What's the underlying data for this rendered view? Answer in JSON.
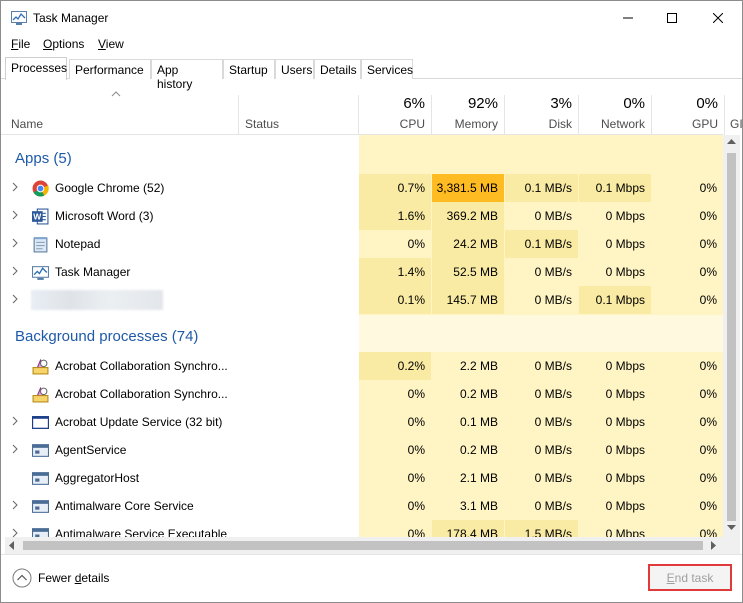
{
  "window": {
    "title": "Task Manager"
  },
  "menu": [
    {
      "accel": "F",
      "rest": "ile"
    },
    {
      "accel": "O",
      "rest": "ptions"
    },
    {
      "accel": "V",
      "rest": "iew"
    }
  ],
  "tabs": [
    "Processes",
    "Performance",
    "App history",
    "Startup",
    "Users",
    "Details",
    "Services"
  ],
  "active_tab": "Processes",
  "columns": {
    "name": "Name",
    "status": "Status",
    "cpu": {
      "pct": "6%",
      "label": "CPU"
    },
    "memory": {
      "pct": "92%",
      "label": "Memory"
    },
    "disk": {
      "pct": "3%",
      "label": "Disk"
    },
    "network": {
      "pct": "0%",
      "label": "Network"
    },
    "gpu": {
      "pct": "0%",
      "label": "GPU"
    },
    "gpu_engine_partial": "GI"
  },
  "groups": {
    "apps": "Apps (5)",
    "background": "Background processes (74)"
  },
  "apps": [
    {
      "name": "Google Chrome (52)",
      "icon": "chrome-icon",
      "cpu": "0.7%",
      "memory": "3,381.5 MB",
      "disk": "0.1 MB/s",
      "network": "0.1 Mbps",
      "gpu": "0%"
    },
    {
      "name": "Microsoft Word (3)",
      "icon": "word-icon",
      "cpu": "1.6%",
      "memory": "369.2 MB",
      "disk": "0 MB/s",
      "network": "0 Mbps",
      "gpu": "0%"
    },
    {
      "name": "Notepad",
      "icon": "notepad-icon",
      "cpu": "0%",
      "memory": "24.2 MB",
      "disk": "0.1 MB/s",
      "network": "0 Mbps",
      "gpu": "0%"
    },
    {
      "name": "Task Manager",
      "icon": "task-manager-icon",
      "cpu": "1.4%",
      "memory": "52.5 MB",
      "disk": "0 MB/s",
      "network": "0 Mbps",
      "gpu": "0%"
    },
    {
      "name": "",
      "icon": "blurred-app-icon",
      "cpu": "0.1%",
      "memory": "145.7 MB",
      "disk": "0 MB/s",
      "network": "0.1 Mbps",
      "gpu": "0%"
    }
  ],
  "background": [
    {
      "name": "Acrobat Collaboration Synchro...",
      "icon": "acrobat-sync-icon",
      "cpu": "0.2%",
      "memory": "2.2 MB",
      "disk": "0 MB/s",
      "network": "0 Mbps",
      "gpu": "0%"
    },
    {
      "name": "Acrobat Collaboration Synchro...",
      "icon": "acrobat-sync-icon",
      "cpu": "0%",
      "memory": "0.2 MB",
      "disk": "0 MB/s",
      "network": "0 Mbps",
      "gpu": "0%"
    },
    {
      "name": "Acrobat Update Service (32 bit)",
      "icon": "service-window-icon",
      "cpu": "0%",
      "memory": "0.1 MB",
      "disk": "0 MB/s",
      "network": "0 Mbps",
      "gpu": "0%"
    },
    {
      "name": "AgentService",
      "icon": "service-window-icon",
      "cpu": "0%",
      "memory": "0.2 MB",
      "disk": "0 MB/s",
      "network": "0 Mbps",
      "gpu": "0%"
    },
    {
      "name": "AggregatorHost",
      "icon": "service-window-icon",
      "cpu": "0%",
      "memory": "2.1 MB",
      "disk": "0 MB/s",
      "network": "0 Mbps",
      "gpu": "0%"
    },
    {
      "name": "Antimalware Core Service",
      "icon": "service-window-icon",
      "cpu": "0%",
      "memory": "3.1 MB",
      "disk": "0 MB/s",
      "network": "0 Mbps",
      "gpu": "0%"
    },
    {
      "name": "Antimalware Service Executable",
      "icon": "service-window-icon",
      "cpu": "0%",
      "memory": "178.4 MB",
      "disk": "1.5 MB/s",
      "network": "0 Mbps",
      "gpu": "0%"
    }
  ],
  "footer": {
    "fewer_details_accel": "d",
    "fewer_details_pre": "Fewer ",
    "fewer_details_post": "etails",
    "end_task_accel": "E",
    "end_task_rest": "nd task"
  },
  "colors": {
    "heat_pale": "#fff4c4",
    "heat_bright": "#f9eba3",
    "heat_hot": "#ffbb22",
    "group_blue": "#1e5aa8",
    "highlight_red": "#e03a3a"
  }
}
